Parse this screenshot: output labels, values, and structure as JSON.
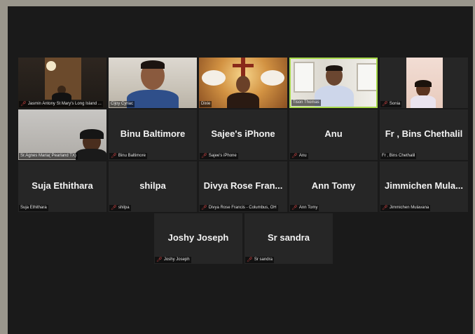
{
  "meeting": {
    "tiles": [
      {
        "display_name": "",
        "label": "Jasmin Antony St Mary's Long Island ...",
        "muted": true,
        "video": "v-room"
      },
      {
        "display_name": "",
        "label": "Cijoy Cyriac",
        "muted": false,
        "video": "v-white"
      },
      {
        "display_name": "",
        "label": "Dixie",
        "muted": false,
        "video": "v-warm"
      },
      {
        "display_name": "",
        "label": "Tison Thomas",
        "muted": false,
        "video": "v-home"
      },
      {
        "display_name": "",
        "label": "Sonia",
        "muted": true,
        "video": "v-pink"
      },
      {
        "display_name": "",
        "label": "Sr.Agnes Maria( Pearland TX)",
        "muted": false,
        "video": "v-grey"
      },
      {
        "display_name": "Binu Baltimore",
        "label": "Binu Baltimore",
        "muted": true
      },
      {
        "display_name": "Sajee's iPhone",
        "label": "Sajee's iPhone",
        "muted": true
      },
      {
        "display_name": "Anu",
        "label": "Anu",
        "muted": true
      },
      {
        "display_name": "Fr , Bins Chethalil",
        "label": "Fr , Bins Chethalil",
        "muted": false
      },
      {
        "display_name": "Suja Ethithara",
        "label": "Suja Ethithara",
        "muted": false
      },
      {
        "display_name": "shilpa",
        "label": "shilpa",
        "muted": true
      },
      {
        "display_name": "Divya Rose Fran...",
        "label": "Divya Rose Francis - Columbus, OH",
        "muted": true
      },
      {
        "display_name": "Ann Tomy",
        "label": "Ann Tomy",
        "muted": true
      },
      {
        "display_name": "Jimmichen Mula...",
        "label": "Jimmichen Mulavana",
        "muted": true
      },
      {
        "display_name": "Joshy Joseph",
        "label": "Joshy Joseph",
        "muted": true
      },
      {
        "display_name": "Sr sandra",
        "label": "Sr sandra",
        "muted": true
      }
    ],
    "active_speaker_index": 3,
    "colors": {
      "active_border": "#a7d94a",
      "mute_icon": "#e04848",
      "tile_bg": "#262626",
      "window_bg": "#1a1a1a"
    }
  }
}
